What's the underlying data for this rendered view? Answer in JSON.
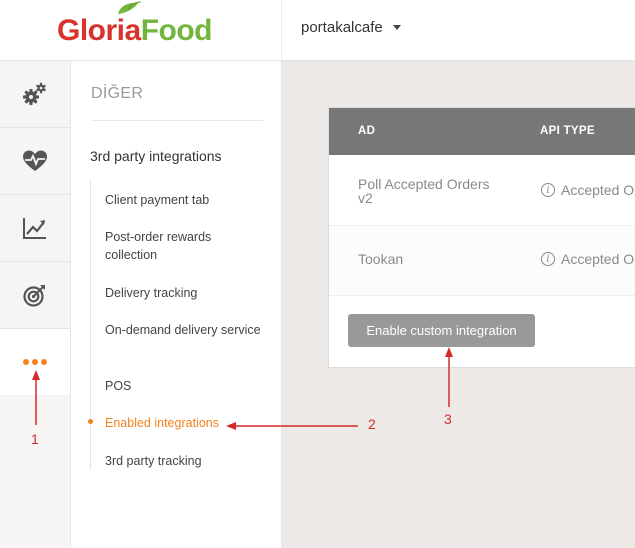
{
  "header": {
    "logo_part1": "Gloria",
    "logo_part2": "Food",
    "restaurant": "portakalcafe"
  },
  "rail": {
    "items": [
      {
        "icon": "gears-icon"
      },
      {
        "icon": "heart-pulse-icon"
      },
      {
        "icon": "chart-icon"
      },
      {
        "icon": "target-icon"
      },
      {
        "icon": "more-dots-icon",
        "active": true
      }
    ]
  },
  "submenu": {
    "section": "DİĞER",
    "group": "3rd party integrations",
    "items": [
      {
        "label": "Client payment tab"
      },
      {
        "label": "Post-order rewards collection"
      },
      {
        "label": "Delivery tracking"
      },
      {
        "label": "On-demand delivery service"
      },
      {
        "label": "POS"
      },
      {
        "label": "Enabled integrations",
        "active": true
      },
      {
        "label": "3rd party tracking"
      }
    ]
  },
  "table": {
    "columns": [
      "AD",
      "API TYPE"
    ],
    "rows": [
      {
        "name": "Poll Accepted Orders v2",
        "type": "Accepted Or"
      },
      {
        "name": "Tookan",
        "type": "Accepted Or"
      }
    ],
    "button": "Enable custom integration"
  },
  "annotations": {
    "labels": [
      "1",
      "2",
      "3"
    ],
    "color": "#d62a2a"
  },
  "colors": {
    "accent": "#f58220",
    "logo_red": "#d7322b",
    "logo_green": "#72b63e"
  }
}
